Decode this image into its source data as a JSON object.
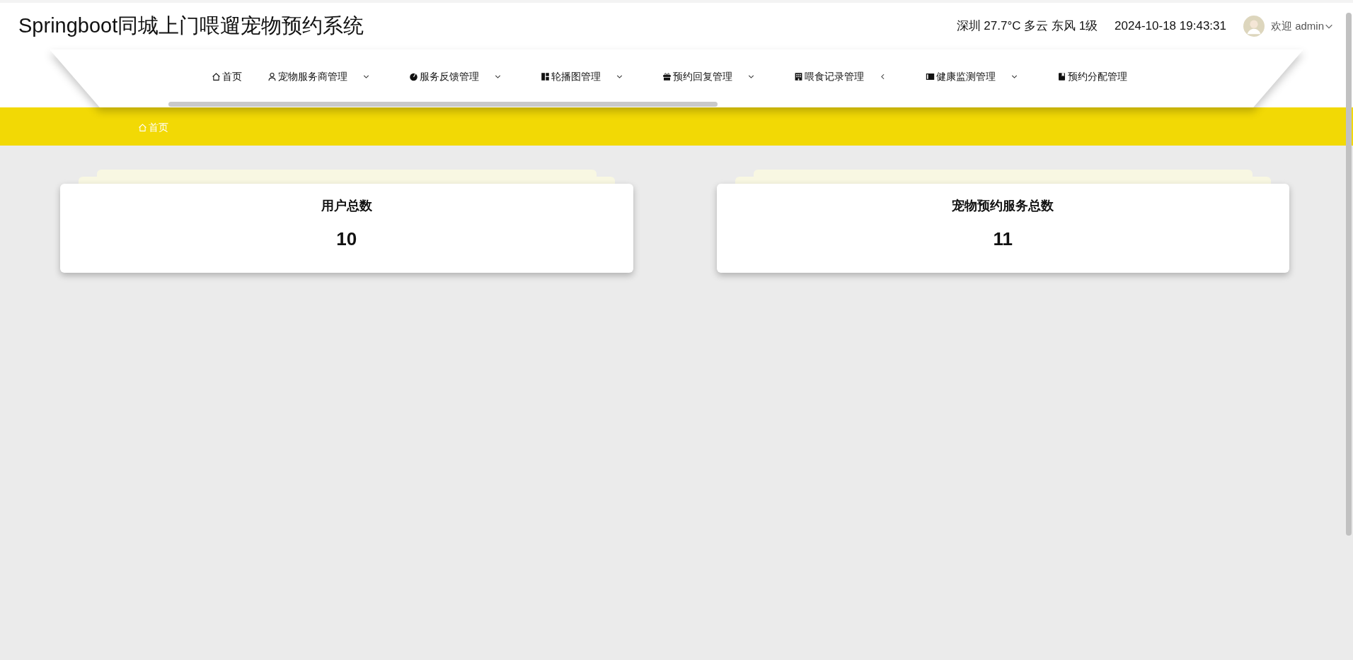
{
  "header": {
    "title": "Springboot同城上门喂遛宠物预约系统",
    "weather": "深圳 27.7°C 多云 东风 1级",
    "datetime": "2024-10-18 19:43:31",
    "welcome": "欢迎 admin"
  },
  "nav": [
    {
      "label": "首页"
    },
    {
      "label": "宠物服务商管理",
      "submenu": true,
      "caret_left": false
    },
    {
      "label": "服务反馈管理",
      "submenu": true,
      "caret_left": false
    },
    {
      "label": "轮播图管理",
      "submenu": true,
      "caret_left": false
    },
    {
      "label": "预约回复管理",
      "submenu": true,
      "caret_left": false
    },
    {
      "label": "喂食记录管理",
      "submenu": true,
      "caret_left": true
    },
    {
      "label": "健康监测管理",
      "submenu": true,
      "caret_left": false
    },
    {
      "label": "预约分配管理"
    }
  ],
  "breadcrumb": "首页",
  "stats": [
    {
      "title": "用户总数",
      "value": "10"
    },
    {
      "title": "宠物预约服务总数",
      "value": "11"
    }
  ]
}
